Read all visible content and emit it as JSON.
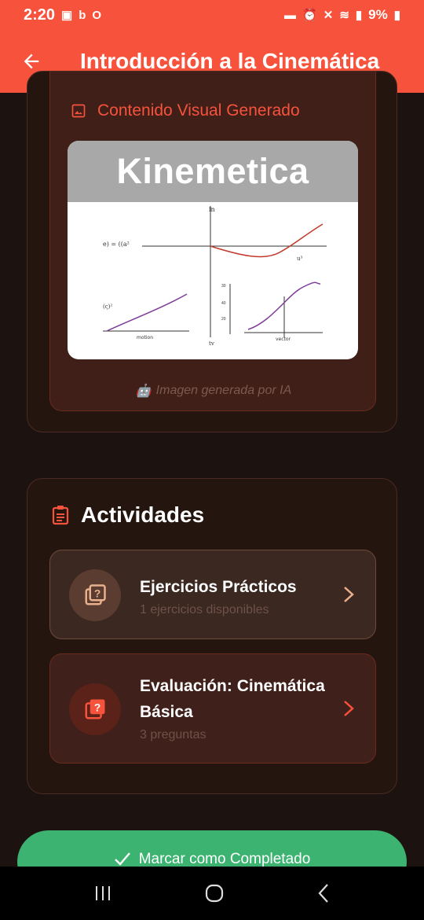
{
  "status": {
    "time": "2:20",
    "battery": "9%"
  },
  "appbar": {
    "title": "Introducción a la Cinemática"
  },
  "visual": {
    "header": "Contenido Visual Generado",
    "image_title": "Kinemetica",
    "caption": "Imagen generada por IA",
    "plot_labels": {
      "top_axis": "in",
      "eq1": "e) = ((a²",
      "u": "u³",
      "eq2": "(ς)²",
      "motion": "motion",
      "tv": "tv",
      "vector": "vector",
      "t30": "30",
      "t40": "40",
      "t20": "20"
    }
  },
  "activities": {
    "title": "Actividades",
    "items": [
      {
        "name": "Ejercicios Prácticos",
        "sub": "1 ejercicios disponibles"
      },
      {
        "name": "Evaluación: Cinemática Básica",
        "sub": "3 preguntas"
      }
    ]
  },
  "complete_button": {
    "label": "Marcar como Completado"
  },
  "colors": {
    "accent": "#f7523c",
    "success": "#3cb371",
    "background": "#1c1310"
  }
}
